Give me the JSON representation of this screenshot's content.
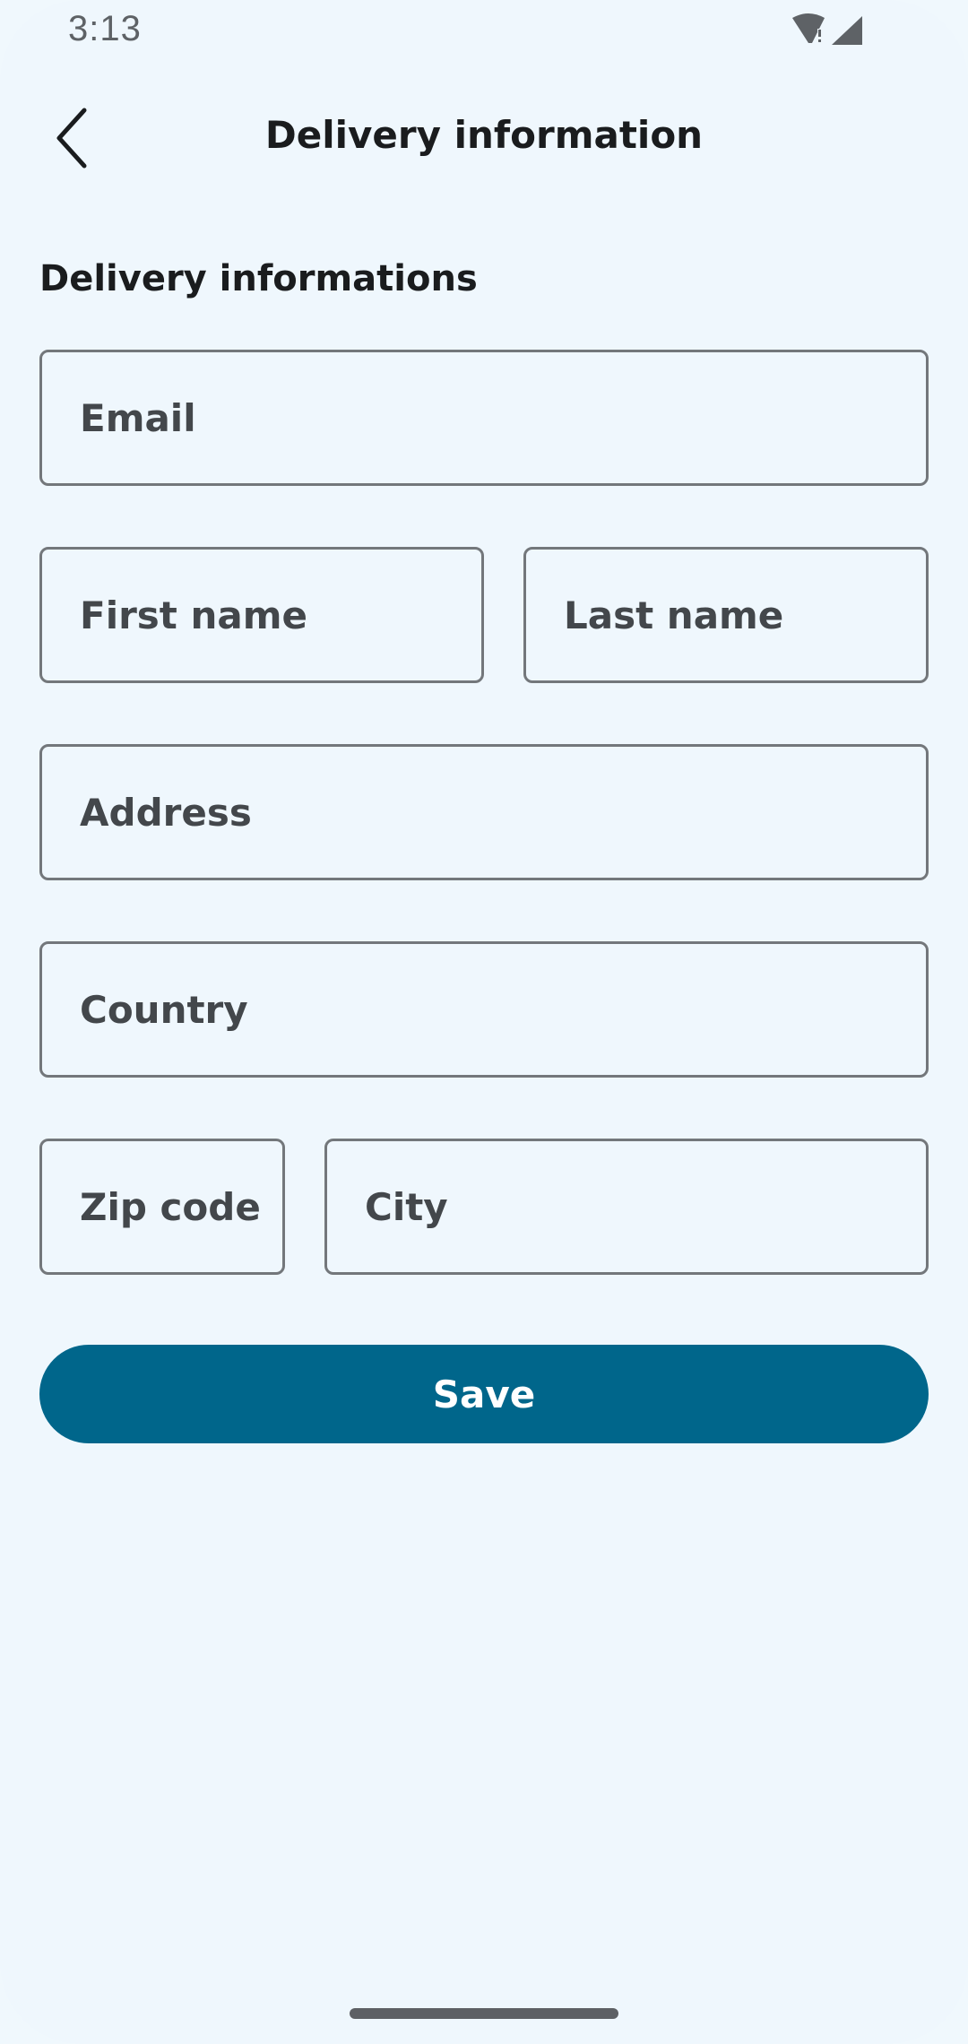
{
  "status_bar": {
    "time": "3:13",
    "icons": [
      "wifi-alert-icon",
      "cell-signal-icon"
    ]
  },
  "app_bar": {
    "title": "Delivery information",
    "back_icon": "chevron-left-icon"
  },
  "form": {
    "section_title": "Delivery informations",
    "fields": {
      "email": {
        "placeholder": "Email",
        "value": ""
      },
      "first_name": {
        "placeholder": "First name",
        "value": ""
      },
      "last_name": {
        "placeholder": "Last name",
        "value": ""
      },
      "address": {
        "placeholder": "Address",
        "value": ""
      },
      "country": {
        "placeholder": "Country",
        "value": ""
      },
      "zip_code": {
        "placeholder": "Zip code",
        "value": ""
      },
      "city": {
        "placeholder": "City",
        "value": ""
      }
    },
    "save_label": "Save"
  },
  "colors": {
    "background": "#eff7fd",
    "primary": "#00668b",
    "outline": "#73777b",
    "label": "#43474b"
  }
}
